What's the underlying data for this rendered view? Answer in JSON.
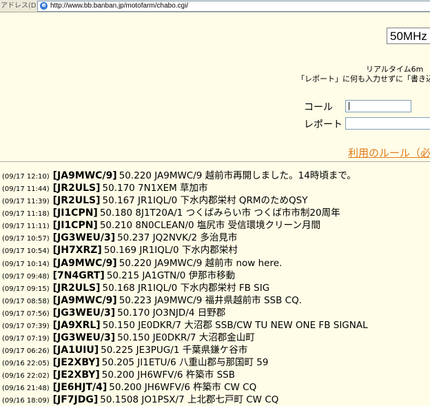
{
  "address_bar": {
    "label": "アドレス(D)",
    "url": "http://www.bb.banban.jp/motofarm/chabo.cgi/"
  },
  "band_select": {
    "selected": "50MHz"
  },
  "info": {
    "line1": "リアルタイム6m",
    "line2": "「レポート」に何も入力せずに「書き込"
  },
  "form": {
    "call_label": "コール",
    "call_value": "",
    "report_label": "レポート",
    "report_value": ""
  },
  "rules_link": "利用のルール（必",
  "entries": [
    {
      "time": "(09/17 12:10)",
      "call": "[JA9MWC/9]",
      "msg": "50.220 JA9MWC/9 越前市再開しました。14時頃まで。"
    },
    {
      "time": "(09/17 11:44)",
      "call": "[JR2ULS]",
      "msg": "50.170 7N1XEM 草加市"
    },
    {
      "time": "(09/17 11:39)",
      "call": "[JR2ULS]",
      "msg": "50.167 JR1IQL/0 下水内郡栄村 QRMのためQSY"
    },
    {
      "time": "(09/17 11:18)",
      "call": "[JI1CPN]",
      "msg": "50.180 8J1T20A/1 つくばみらい市 つくば市市制20周年"
    },
    {
      "time": "(09/17 11:11)",
      "call": "[JI1CPN]",
      "msg": "50.210 8N0CLEAN/0 塩尻市 受信環境クリーン月間"
    },
    {
      "time": "(09/17 10:57)",
      "call": "[JG3WEU/3]",
      "msg": "50.237 JQ2NVK/2 多治見市"
    },
    {
      "time": "(09/17 10:54)",
      "call": "[JH7XRZ]",
      "msg": "50.169 JR1IQL/0 下水内郡栄村"
    },
    {
      "time": "(09/17 10:14)",
      "call": "[JA9MWC/9]",
      "msg": "50.220 JA9MWC/9 越前市 now here."
    },
    {
      "time": "(09/17 09:48)",
      "call": "[7N4GRT]",
      "msg": "50.215 JA1GTN/0 伊那市移動"
    },
    {
      "time": "(09/17 09:15)",
      "call": "[JR2ULS]",
      "msg": "50.168 JR1IQL/0 下水内郡栄村 FB SIG"
    },
    {
      "time": "(09/17 08:58)",
      "call": "[JA9MWC/9]",
      "msg": "50.223 JA9MWC/9 福井県越前市 SSB CQ."
    },
    {
      "time": "(09/17 07:56)",
      "call": "[JG3WEU/3]",
      "msg": "50.170 JO3NJD/4 日野郡"
    },
    {
      "time": "(09/17 07:39)",
      "call": "[JA9XRL]",
      "msg": "50.150 JE0DKR/7 大沼郡 SSB/CW TU NEW ONE FB SIGNAL"
    },
    {
      "time": "(09/17 07:19)",
      "call": "[JG3WEU/3]",
      "msg": "50.150 JE0DKR/7 大沼郡金山町"
    },
    {
      "time": "(09/17 06:26)",
      "call": "[JA1UIU]",
      "msg": "50.225 JE3PUG/1 千葉県鎌ケ谷市"
    },
    {
      "time": "(09/16 22:05)",
      "call": "[JE2XBY]",
      "msg": "50.205 JI1ETU/6 八重山郡与那国町 59"
    },
    {
      "time": "(09/16 22:02)",
      "call": "[JE2XBY]",
      "msg": "50.200 JH6WFV/6 杵築市 SSB"
    },
    {
      "time": "(09/16 21:48)",
      "call": "[JE6HJT/4]",
      "msg": "50.200 JH6WFV/6 杵築市 CW CQ"
    },
    {
      "time": "(09/16 18:09)",
      "call": "[JF7JDG]",
      "msg": "50.1508 JO1PSX/7 上北郡七戸町 CW CQ"
    }
  ]
}
